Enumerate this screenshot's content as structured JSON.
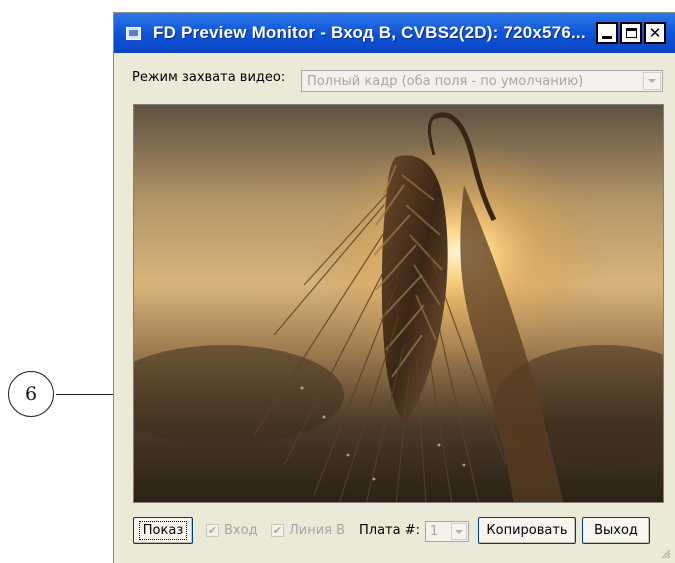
{
  "callout": {
    "number": "6"
  },
  "window": {
    "title": "FD Preview Monitor - Вход B, CVBS2(2D): 720x576...",
    "controls": {
      "minimize_icon": "minimize-icon",
      "maximize_icon": "maximize-icon",
      "close_icon": "close-icon"
    }
  },
  "capture_mode": {
    "label": "Режим захвата видео:",
    "selected": "Полный кадр (оба поля - по умолчанию)"
  },
  "preview": {
    "description_icon": "video-preview-frame"
  },
  "bottom_bar": {
    "show_button": "Показ",
    "input_checkbox": {
      "label": "Вход",
      "checked": true,
      "enabled": false
    },
    "line_checkbox": {
      "label": "Линия B",
      "checked": true,
      "enabled": false
    },
    "board_label": "Плата #:",
    "board_selected": "1",
    "copy_button": "Копировать",
    "exit_button": "Выход"
  },
  "colors": {
    "titlebar": "#0F52D6",
    "window_bg": "#ECE9D8",
    "disabled_text": "#A7A6AA"
  }
}
